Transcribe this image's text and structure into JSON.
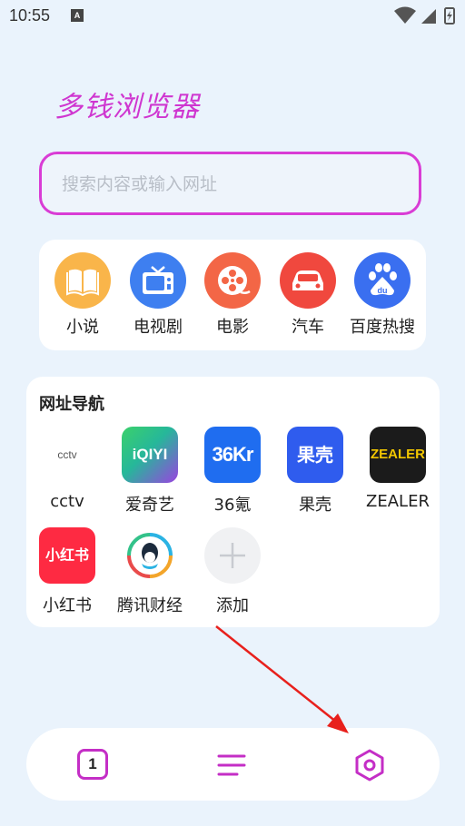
{
  "status": {
    "time": "10:55",
    "notif_glyph": "A"
  },
  "brand": {
    "title": "多钱浏览器"
  },
  "search": {
    "placeholder": "搜索内容或输入网址",
    "value": ""
  },
  "quick_links": [
    {
      "label": "小说",
      "icon": "book-icon",
      "color": "#f9b54a"
    },
    {
      "label": "电视剧",
      "icon": "tv-icon",
      "color": "#3e7ff0"
    },
    {
      "label": "电影",
      "icon": "film-reel-icon",
      "color": "#f36646"
    },
    {
      "label": "汽车",
      "icon": "car-icon",
      "color": "#f0483e"
    },
    {
      "label": "百度热搜",
      "icon": "baidu-paw-icon",
      "color": "#3a6ff0"
    }
  ],
  "nav": {
    "title": "网址导航",
    "sites": [
      {
        "label": "cctv",
        "logo_text": "cctv",
        "icon": "cctv-logo"
      },
      {
        "label": "爱奇艺",
        "logo_text": "iQIYI",
        "icon": "iqiyi-logo"
      },
      {
        "label": "36氪",
        "logo_text": "36Kr",
        "icon": "36kr-logo"
      },
      {
        "label": "果壳",
        "logo_text": "果壳",
        "icon": "guokr-logo"
      },
      {
        "label": "ZEALER",
        "logo_text": "ZEALER",
        "icon": "zealer-logo"
      },
      {
        "label": "小红书",
        "logo_text": "小红书",
        "icon": "xiaohongshu-logo"
      },
      {
        "label": "腾讯财经",
        "logo_text": "",
        "icon": "tencent-finance-logo"
      },
      {
        "label": "添加",
        "logo_text": "",
        "icon": "plus-icon"
      }
    ]
  },
  "bottom_bar": {
    "tab_count": "1",
    "accent": "#c42ec6"
  },
  "colors": {
    "background": "#eaf3fc",
    "accent": "#d93cd5",
    "arrow": "#e8201c"
  }
}
